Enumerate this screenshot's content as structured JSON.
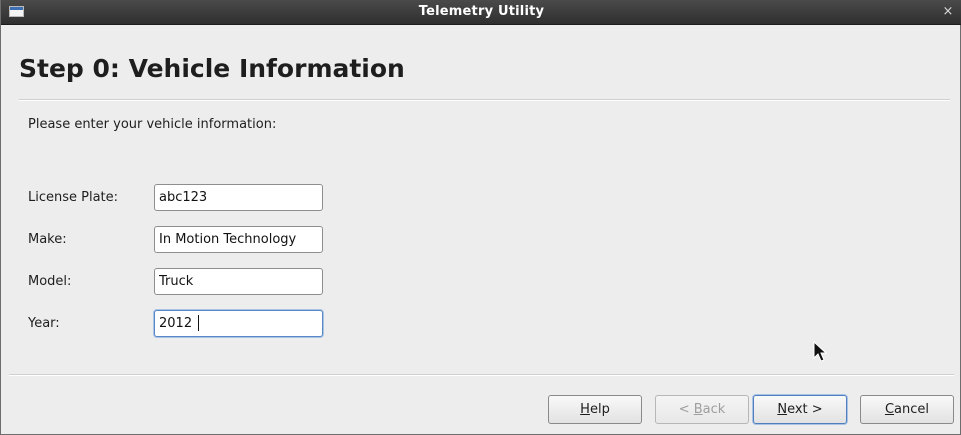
{
  "window": {
    "title": "Telemetry Utility",
    "close_glyph": "×"
  },
  "page": {
    "title": "Step 0: Vehicle Information",
    "intro": "Please enter your vehicle information:"
  },
  "fields": [
    {
      "label": "License Plate:",
      "value": "abc123"
    },
    {
      "label": "Make:",
      "value": "In Motion Technology"
    },
    {
      "label": "Model:",
      "value": "Truck"
    },
    {
      "label": "Year:",
      "value": "2012"
    }
  ],
  "buttons": {
    "help": {
      "mnemonic": "H",
      "rest": "elp"
    },
    "back": {
      "prefix": "< ",
      "mnemonic": "B",
      "rest": "ack"
    },
    "next": {
      "mnemonic": "N",
      "rest": "ext >"
    },
    "cancel": {
      "mnemonic": "C",
      "rest": "ancel"
    }
  },
  "icons": {
    "window": "window-icon",
    "close": "close-icon",
    "pointer": "mouse-pointer-icon"
  },
  "colors": {
    "titlebar": "#2f2f2f",
    "background": "#ededed",
    "focus": "#5a88c6"
  }
}
